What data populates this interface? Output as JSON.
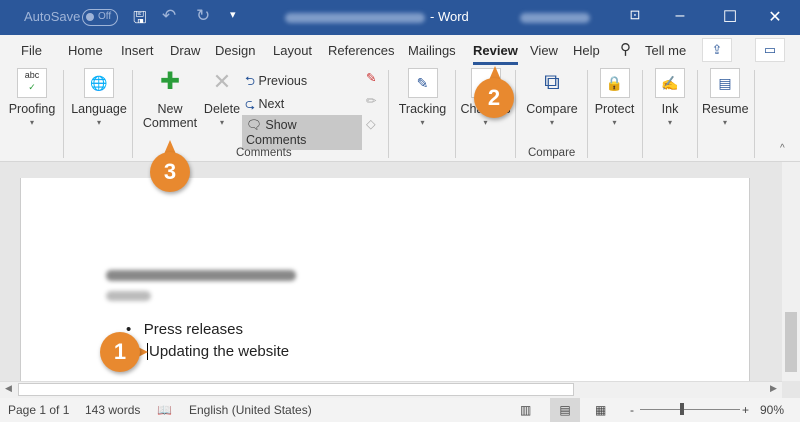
{
  "titlebar": {
    "autosave_label": "AutoSave",
    "autosave_state": "Off",
    "app_title": "- Word",
    "icons": [
      "save-icon",
      "undo-icon",
      "redo-icon",
      "customize-icon",
      "ribbon-display-icon",
      "minimize-icon",
      "maximize-icon",
      "close-icon"
    ]
  },
  "tabs": [
    "File",
    "Home",
    "Insert",
    "Draw",
    "Design",
    "Layout",
    "References",
    "Mailings",
    "Review",
    "View",
    "Help"
  ],
  "active_tab": "Review",
  "tell_me": "Tell me",
  "ribbon": {
    "proofing": "Proofing",
    "language": "Language",
    "new": "New",
    "comment": "Comment",
    "delete": "Delete",
    "previous": "Previous",
    "next": "Next",
    "show_comments": "Show Comments",
    "comments_group": "Comments",
    "tracking": "Tracking",
    "changes": "Changes",
    "compare": "Compare",
    "compare_group": "Compare",
    "protect": "Protect",
    "ink": "Ink",
    "resume": "Resume",
    "abc": "abc"
  },
  "document": {
    "bullet": "Press releases",
    "line2": "Updating the website"
  },
  "status": {
    "page": "Page 1 of 1",
    "words": "143 words",
    "language": "English (United States)",
    "zoom": "90%",
    "zoom_level_percent": 90
  },
  "callouts": [
    "1",
    "2",
    "3"
  ],
  "colors": {
    "title_bar": "#2b579a",
    "callout": "#e8892f"
  }
}
